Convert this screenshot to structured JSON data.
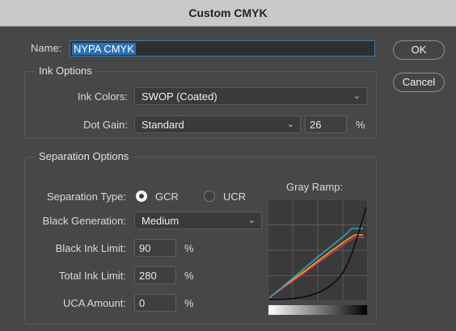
{
  "window": {
    "title": "Custom CMYK"
  },
  "name": {
    "label": "Name:",
    "value": "NYPA CMYK"
  },
  "buttons": {
    "ok": "OK",
    "cancel": "Cancel"
  },
  "ink_options": {
    "title": "Ink Options",
    "ink_colors_label": "Ink Colors:",
    "ink_colors_value": "SWOP (Coated)",
    "dot_gain_label": "Dot Gain:",
    "dot_gain_mode": "Standard",
    "dot_gain_value": "26",
    "dot_gain_unit": "%"
  },
  "separation": {
    "title": "Separation Options",
    "type_label": "Separation Type:",
    "gcr_label": "GCR",
    "ucr_label": "UCR",
    "selected": "GCR",
    "black_gen_label": "Black Generation:",
    "black_gen_value": "Medium",
    "black_ink_limit_label": "Black Ink Limit:",
    "black_ink_limit_value": "90",
    "total_ink_limit_label": "Total Ink Limit:",
    "total_ink_limit_value": "280",
    "uca_amount_label": "UCA Amount:",
    "uca_amount_value": "0",
    "percent": "%"
  },
  "gray_ramp": {
    "label": "Gray Ramp:",
    "colors": {
      "cyan": "#2fa6c8",
      "magenta": "#e03a52",
      "yellow": "#f2b020",
      "black": "#000000"
    }
  },
  "icons": {
    "chevron": "chevron-down-icon"
  }
}
